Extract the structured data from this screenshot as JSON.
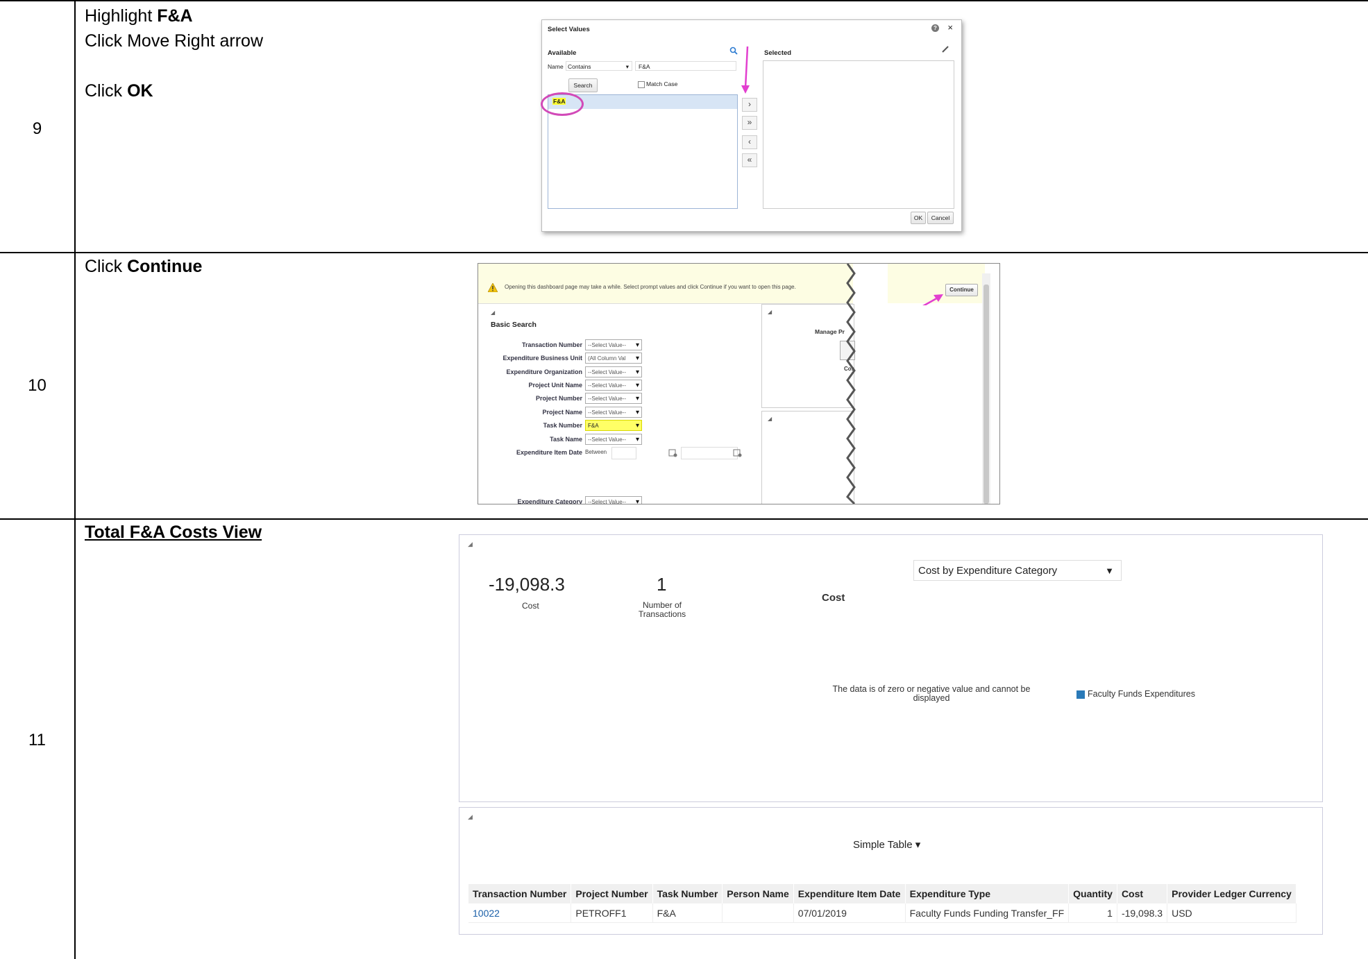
{
  "steps": [
    {
      "number": "9",
      "instructions": [
        {
          "prefix": "Highlight ",
          "bold": "F&A"
        },
        {
          "prefix": "Click Move Right arrow",
          "bold": ""
        },
        {
          "prefix": "Click ",
          "bold": "OK"
        }
      ],
      "dialog": {
        "title": "Select Values",
        "help_icon": "?",
        "close_icon": "×",
        "available_label": "Available",
        "selected_label": "Selected",
        "name_label": "Name",
        "operator_value": "Contains",
        "search_value": "F&A",
        "search_button": "Search",
        "match_case_label": "Match Case",
        "available_items": [
          "F&A"
        ],
        "move_buttons": [
          "›",
          "»",
          "‹",
          "«"
        ],
        "ok_button": "OK",
        "cancel_button": "Cancel"
      }
    },
    {
      "number": "10",
      "instructions": [
        {
          "prefix": "Click ",
          "bold": "Continue"
        }
      ],
      "dashboard": {
        "warning_text": "Opening this dashboard page may take a while. Select prompt values and click Continue if you want to open this page.",
        "continue_button": "Continue",
        "section_title": "Basic Search",
        "manage_label": "Manage Pr",
        "cos_label": "Cos",
        "fields": [
          {
            "label": "Transaction Number",
            "value": "--Select Value--"
          },
          {
            "label": "Expenditure Business Unit",
            "value": "(All Column Val"
          },
          {
            "label": "Expenditure Organization",
            "value": "--Select Value--"
          },
          {
            "label": "Project Unit Name",
            "value": "--Select Value--"
          },
          {
            "label": "Project Number",
            "value": "--Select Value--"
          },
          {
            "label": "Project Name",
            "value": "--Select Value--"
          },
          {
            "label": "Task Number",
            "value": "F&A",
            "highlight": true
          },
          {
            "label": "Task Name",
            "value": "--Select Value--"
          },
          {
            "label": "Expenditure Item Date",
            "value": "Between"
          },
          {
            "label": "Expenditure Category",
            "value": "--Select Value--"
          }
        ]
      }
    },
    {
      "number": "11",
      "heading": "Total F&A Costs View",
      "view": {
        "cost_value": "-19,098.3",
        "cost_label": "Cost",
        "transactions_value": "1",
        "transactions_label_line1": "Number of",
        "transactions_label_line2": "Transactions",
        "dropdown_label": "Cost by Expenditure Category",
        "chart_title": "Cost",
        "no_data_line1": "The data is of zero or negative value and cannot be",
        "no_data_line2": "displayed",
        "legend_label": "Faculty Funds Expenditures",
        "legend_color": "#2a7ab8",
        "table_view_label": "Simple Table ▾",
        "table": {
          "columns": [
            "Transaction Number",
            "Project Number",
            "Task Number",
            "Person Name",
            "Expenditure Item Date",
            "Expenditure Type",
            "Quantity",
            "Cost",
            "Provider Ledger Currency"
          ],
          "rows": [
            [
              "10022",
              "PETROFF1",
              "F&A",
              "",
              "07/01/2019",
              "Faculty Funds Funding Transfer_FF",
              "1",
              "-19,098.3",
              "USD"
            ]
          ]
        }
      }
    }
  ]
}
